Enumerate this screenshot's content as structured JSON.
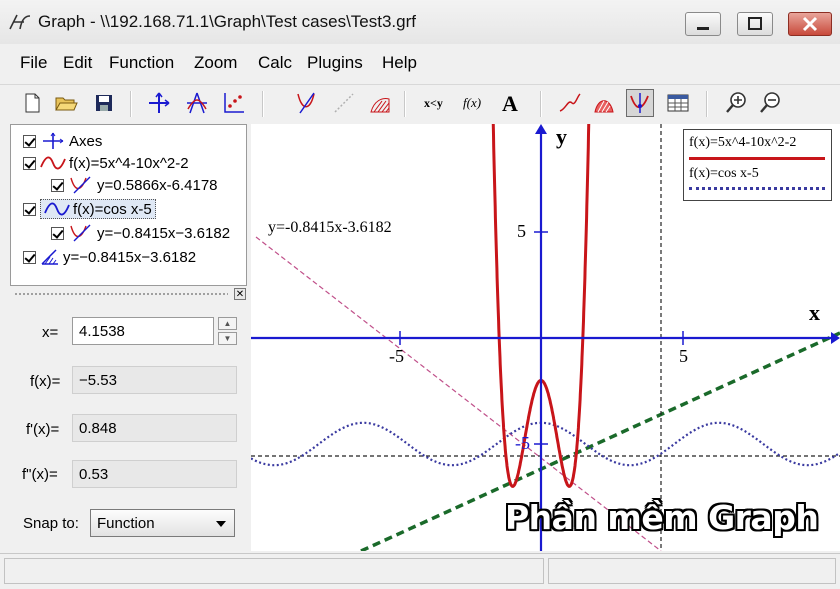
{
  "window": {
    "title": "Graph - \\\\192.168.71.1\\Graph\\Test cases\\Test3.grf",
    "app_icon": "graph-app-icon",
    "controls": [
      "minimize-icon",
      "maximize-icon",
      "close-icon"
    ]
  },
  "menu": [
    "File",
    "Edit",
    "Function",
    "Zoom",
    "Calc",
    "Plugins",
    "Help"
  ],
  "toolbar": {
    "buttons": [
      "new-icon",
      "open-icon",
      "save-icon",
      "axes-icon",
      "insert-function-icon",
      "insert-point-series-icon",
      "tangent-icon",
      "insert-relation-icon",
      "insert-shading-icon",
      "evaluate-icon",
      "table-icon",
      "label-icon",
      "trendline-icon",
      "integrate-icon",
      "evaluate-pressed-icon",
      "table-view-icon",
      "zoom-in-icon",
      "zoom-out-icon"
    ],
    "pressed": "evaluate"
  },
  "tree": {
    "items": [
      {
        "label": "Axes",
        "checked": true,
        "icon": "axes-icon"
      },
      {
        "label": "f(x)=5x^4-10x^2-2",
        "checked": true,
        "icon": "function-icon"
      },
      {
        "label": "y=0.5866x-6.4178",
        "checked": true,
        "icon": "tangent-icon"
      },
      {
        "label": "f(x)=cos x-5",
        "checked": true,
        "icon": "function-icon",
        "selected": true
      },
      {
        "label": "y=−0.8415x−3.6182",
        "checked": true,
        "icon": "tangent-icon"
      },
      {
        "label": "y=−0.8415x−3.6182",
        "checked": true,
        "icon": "shading-icon"
      }
    ]
  },
  "evaluate": {
    "x_label": "x=",
    "x_value": "4.1538",
    "fx_label": "f(x)=",
    "fx_value": "−5.53",
    "dfx_label": "f'(x)=",
    "dfx_value": "0.848",
    "ddfx_label": "f\"(x)=",
    "ddfx_value": "0.53",
    "snap_label": "Snap to:",
    "snap_value": "Function"
  },
  "graph": {
    "legend": [
      {
        "label": "f(x)=5x^4-10x^2-2",
        "color": "#c8151a",
        "style": "solid"
      },
      {
        "label": "f(x)=cos x-5",
        "color": "#3a3aa0",
        "style": "dotted"
      }
    ],
    "x_axis_label": "x",
    "y_axis_label": "y",
    "x_ticks": [
      "-5",
      "5"
    ],
    "y_ticks": [
      "5",
      "-5"
    ],
    "tangent_label": "y=-0.8415x-3.6182",
    "axis_color": "#1a1ad0"
  },
  "watermark": "Phần mềm Graph"
}
